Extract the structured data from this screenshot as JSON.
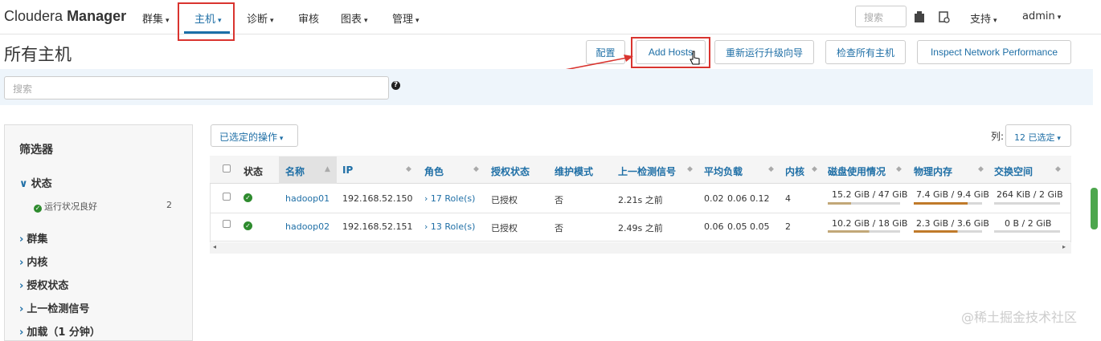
{
  "topnav": {
    "brand_light": "Cloudera",
    "brand_bold": "Manager",
    "items": [
      {
        "label": "群集"
      },
      {
        "label": "主机"
      },
      {
        "label": "诊断"
      },
      {
        "label": "审核"
      },
      {
        "label": "图表"
      },
      {
        "label": "管理"
      }
    ],
    "search_placeholder": "搜索",
    "support": "支持",
    "user": "admin"
  },
  "page": {
    "title": "所有主机",
    "buttons": {
      "config": "配置",
      "add_hosts": "Add Hosts",
      "rerun_upgrade": "重新运行升级向导",
      "inspect_all": "检查所有主机",
      "inspect_network": "Inspect Network Performance"
    },
    "search_placeholder": "搜索",
    "help": "?"
  },
  "filters": {
    "title": "筛选器",
    "groups": [
      {
        "label": "状态"
      },
      {
        "label": "群集"
      },
      {
        "label": "内核"
      },
      {
        "label": "授权状态"
      },
      {
        "label": "上一检测信号"
      },
      {
        "label": "加载（1 分钟）"
      }
    ],
    "status_option": {
      "label": "运行状况良好",
      "count": "2"
    }
  },
  "table": {
    "ops_button": "已选定的操作",
    "columns_label": "列:",
    "columns_selected": "12 已选定",
    "headers": [
      "状态",
      "名称",
      "IP",
      "角色",
      "授权状态",
      "维护模式",
      "上一检测信号",
      "平均负载",
      "内核",
      "磁盘使用情况",
      "物理内存",
      "交换空间"
    ],
    "rows": [
      {
        "name": "hadoop01",
        "ip": "192.168.52.150",
        "roles": "17 Role(s)",
        "auth": "已授权",
        "maint": "否",
        "heartbeat": "2.21s 之前",
        "load": [
          "0.02",
          "0.06",
          "0.12"
        ],
        "cores": "4",
        "disk": "15.2 GiB / 47 GiB",
        "disk_fraction": 0.32,
        "mem": "7.4 GiB / 9.4 GiB",
        "mem_fraction": 0.79,
        "swap": "264 KiB / 2 GiB",
        "swap_fraction": 0.0
      },
      {
        "name": "hadoop02",
        "ip": "192.168.52.151",
        "roles": "13 Role(s)",
        "auth": "已授权",
        "maint": "否",
        "heartbeat": "2.49s 之前",
        "load": [
          "0.06",
          "0.05",
          "0.05"
        ],
        "cores": "2",
        "disk": "10.2 GiB / 18 GiB",
        "disk_fraction": 0.57,
        "mem": "2.3 GiB / 3.6 GiB",
        "mem_fraction": 0.64,
        "swap": "0 B / 2 GiB",
        "swap_fraction": 0.0
      }
    ]
  },
  "watermark": "@稀土掘金技术社区",
  "colors": {
    "accent": "#1f6fa6",
    "highlight": "#d9342f",
    "ok": "#2e8b2e",
    "disk_bar": "#c2a878",
    "mem_bar": "#c07a2a"
  }
}
